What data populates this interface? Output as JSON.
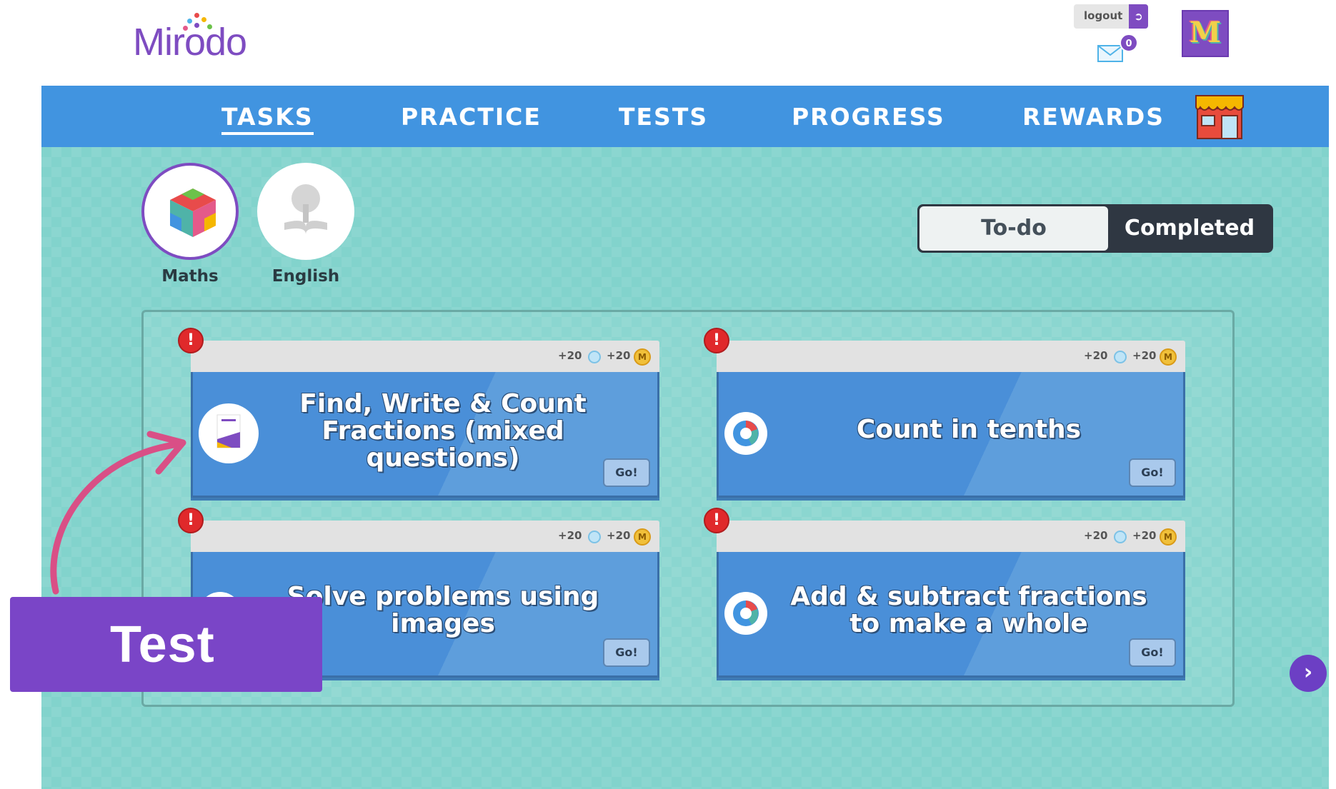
{
  "header": {
    "logo_text": "Mirodo",
    "logout_label": "logout",
    "mail_count": "0",
    "avatar_letter": "M"
  },
  "nav": {
    "items": [
      {
        "label": "TASKS",
        "active": true
      },
      {
        "label": "PRACTICE"
      },
      {
        "label": "TESTS"
      },
      {
        "label": "PROGRESS"
      },
      {
        "label": "REWARDS"
      }
    ]
  },
  "subjects": [
    {
      "label": "Maths",
      "selected": true
    },
    {
      "label": "English"
    }
  ],
  "toggle": {
    "todo_label": "To-do",
    "completed_label": "Completed"
  },
  "tasks": [
    {
      "title": "Find, Write & Count Fractions (mixed questions)",
      "gem_reward": "+20",
      "coin_reward": "+20",
      "go_label": "Go!",
      "alert": "!"
    },
    {
      "title": "Count in tenths",
      "gem_reward": "+20",
      "coin_reward": "+20",
      "go_label": "Go!",
      "alert": "!"
    },
    {
      "title": "Solve problems using images",
      "gem_reward": "+20",
      "coin_reward": "+20",
      "go_label": "Go!",
      "alert": "!"
    },
    {
      "title": "Add & subtract fractions to make a whole",
      "gem_reward": "+20",
      "coin_reward": "+20",
      "go_label": "Go!",
      "alert": "!"
    }
  ],
  "coin_letter": "M",
  "overlay": {
    "test_label": "Test"
  },
  "colors": {
    "brand_purple": "#7e4cc1",
    "nav_blue": "#4194e0",
    "background_teal": "#82d3cc",
    "card_blue": "#4a8fd8",
    "alert_red": "#e0292b",
    "annotation_pink": "#d94f86"
  }
}
